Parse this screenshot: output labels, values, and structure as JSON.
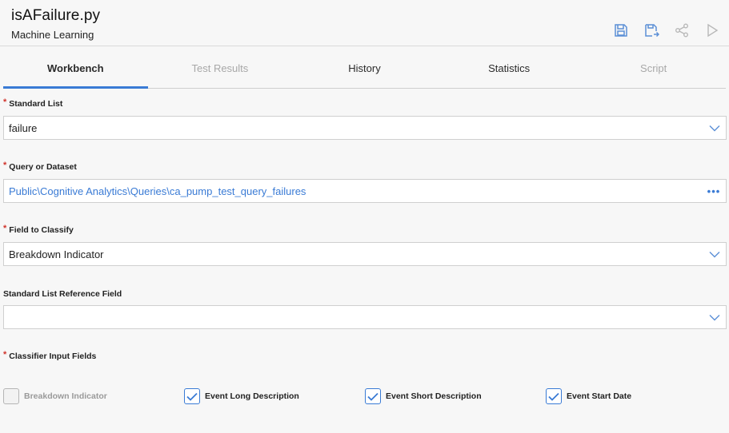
{
  "header": {
    "title": "isAFailure.py",
    "subtitle": "Machine Learning"
  },
  "toolbar": {
    "icons": [
      "save-icon",
      "save-as-icon",
      "share-icon",
      "run-icon"
    ]
  },
  "tabs": [
    {
      "label": "Workbench",
      "state": "active"
    },
    {
      "label": "Test Results",
      "state": "disabled"
    },
    {
      "label": "History",
      "state": "normal"
    },
    {
      "label": "Statistics",
      "state": "normal"
    },
    {
      "label": "Script",
      "state": "disabled"
    }
  ],
  "form": {
    "standard_list": {
      "label": "Standard List",
      "required": "*",
      "value": "failure"
    },
    "query": {
      "label": "Query or Dataset",
      "required": "*",
      "value": "Public\\Cognitive Analytics\\Queries\\ca_pump_test_query_failures"
    },
    "field_to_classify": {
      "label": "Field to Classify",
      "required": "*",
      "value": "Breakdown Indicator"
    },
    "reference_field": {
      "label": "Standard List Reference Field",
      "value": ""
    },
    "classifier_inputs": {
      "label": "Classifier Input Fields",
      "required": "*",
      "options": [
        {
          "label": "Breakdown Indicator",
          "checked": false,
          "disabled": true
        },
        {
          "label": "Event Long Description",
          "checked": true,
          "disabled": false
        },
        {
          "label": "Event Short Description",
          "checked": true,
          "disabled": false
        },
        {
          "label": "Event Start Date",
          "checked": true,
          "disabled": false
        }
      ]
    }
  },
  "colors": {
    "accent": "#3a7bd5",
    "required": "#d0342c",
    "icon": "#5b8fd6",
    "icon_disabled": "#b8b8b8"
  }
}
